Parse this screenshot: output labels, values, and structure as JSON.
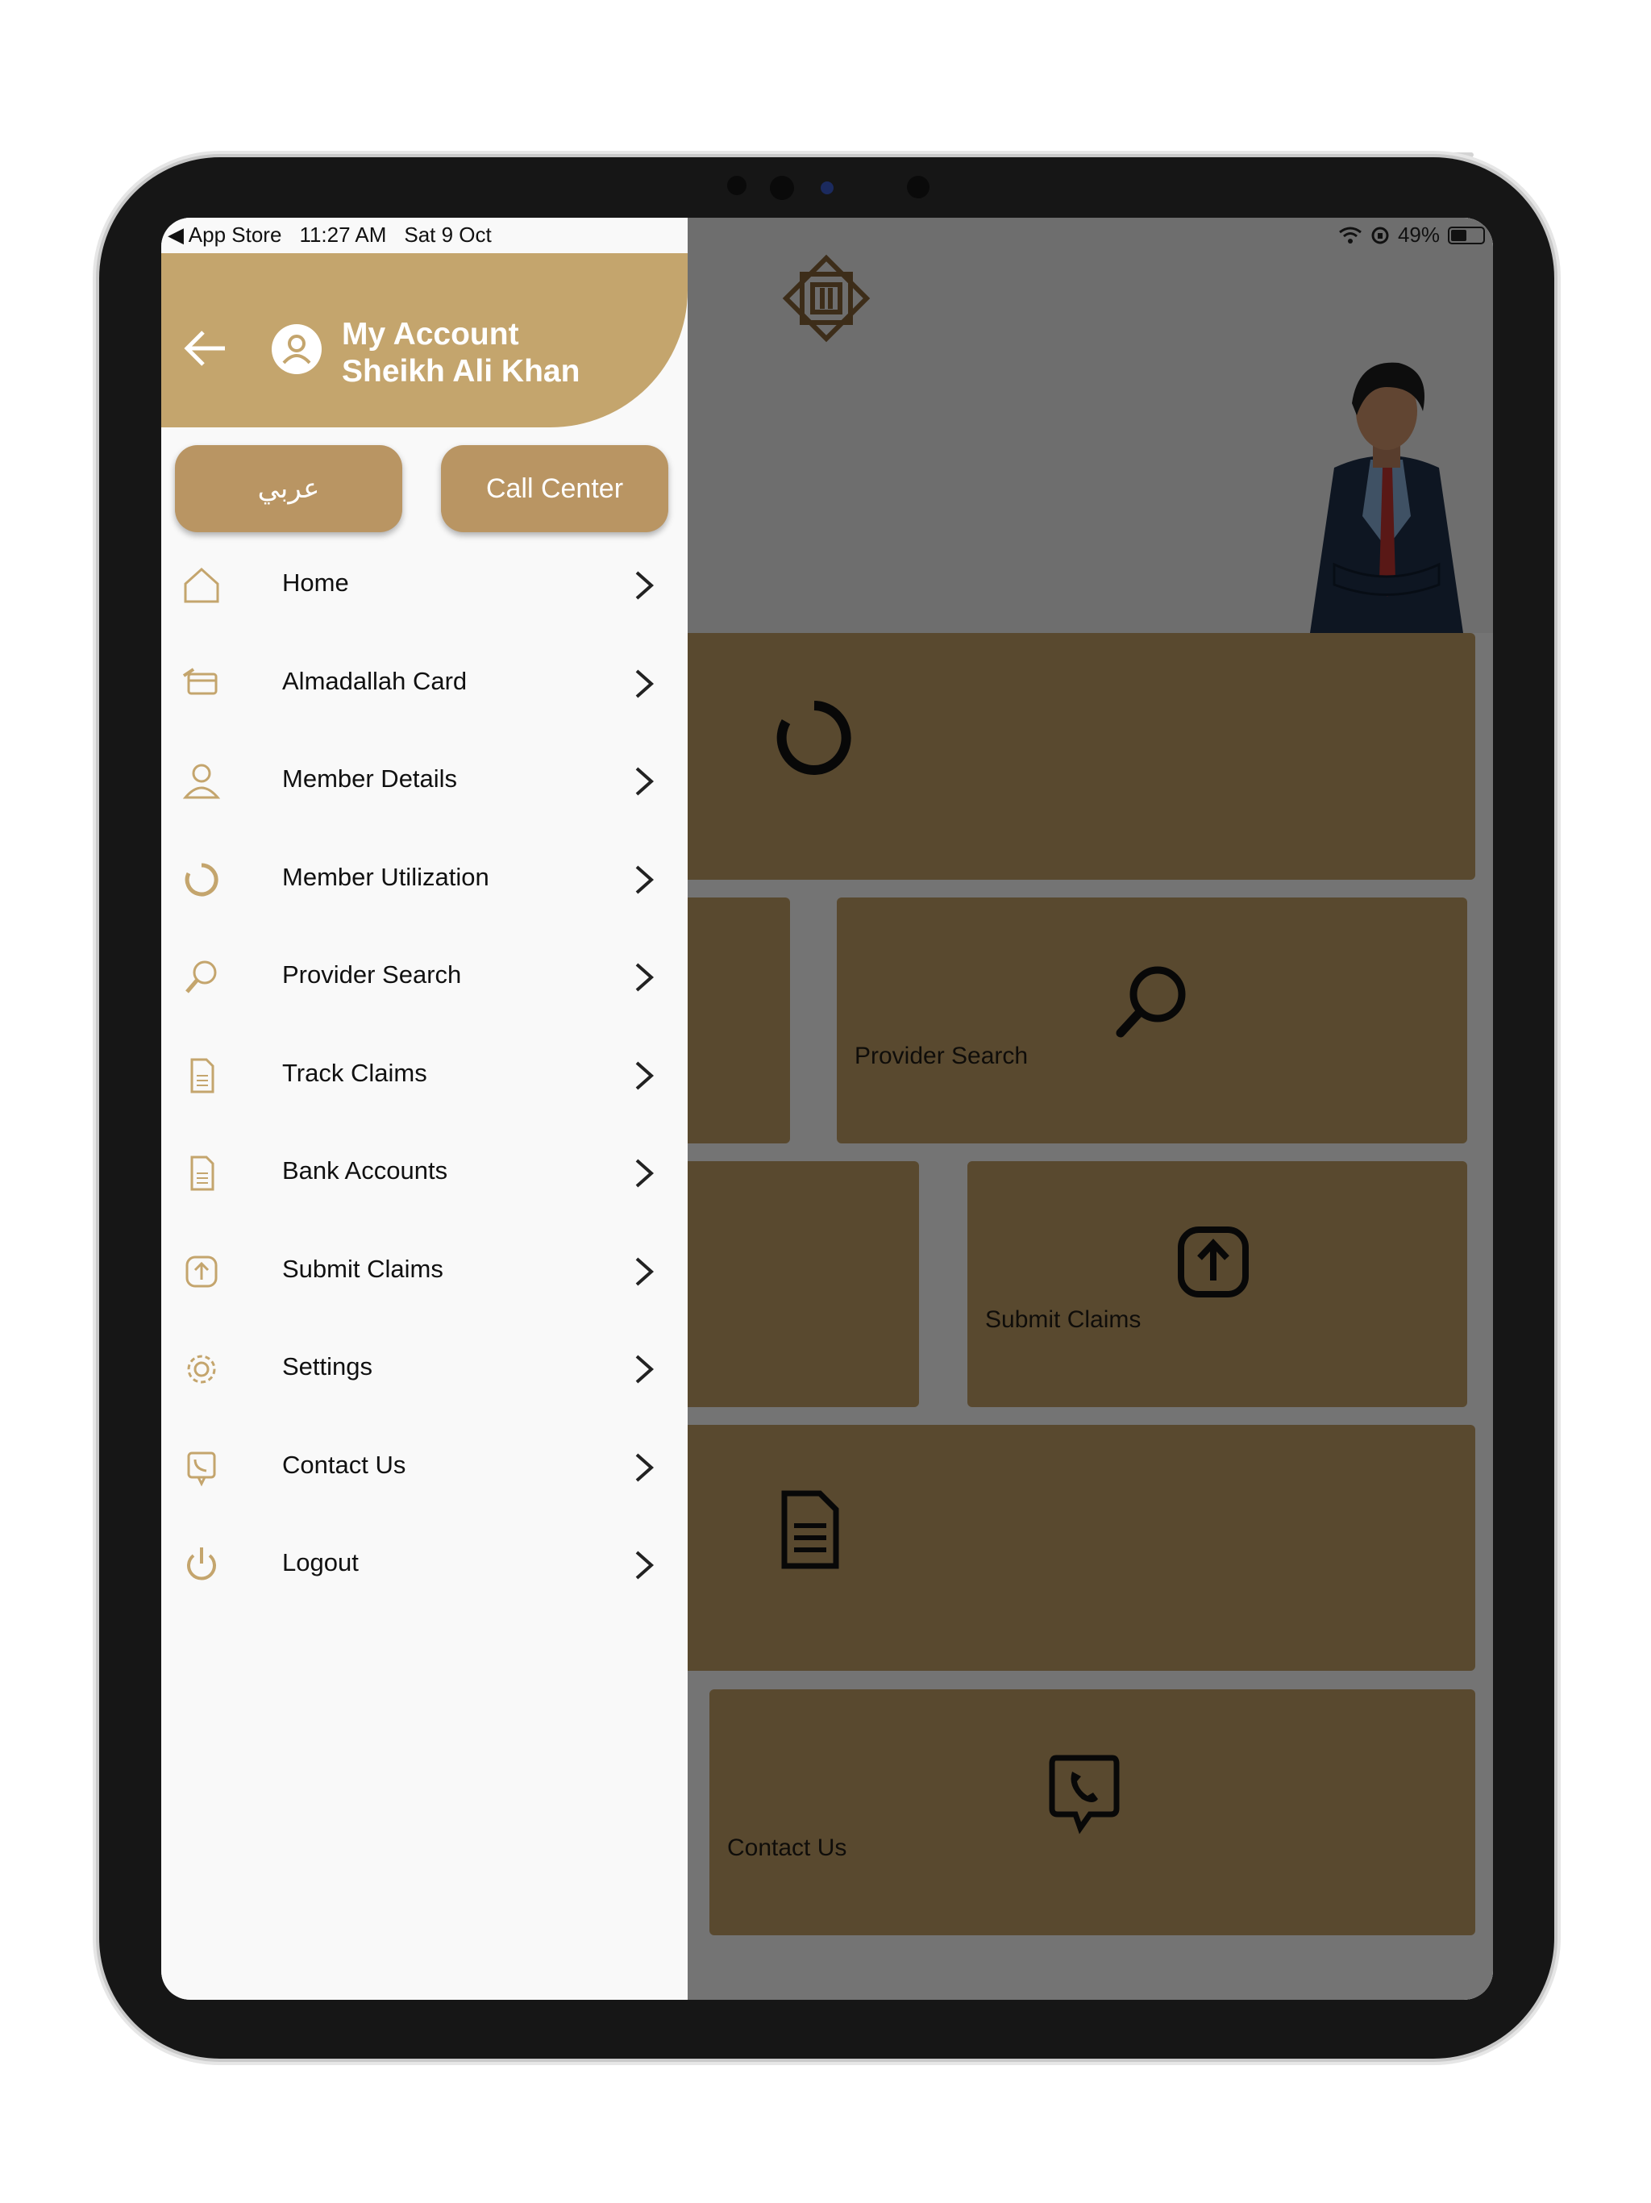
{
  "status_bar": {
    "back_app": "App Store",
    "time": "11:27 AM",
    "date": "Sat 9 Oct",
    "battery": "49%",
    "battery_level": 0.49
  },
  "drawer": {
    "title": "My Account",
    "user_name": "Sheikh Ali Khan",
    "arabic_button": "عربي",
    "call_center_button": "Call Center",
    "items": [
      {
        "label": "Home",
        "icon": "home-icon"
      },
      {
        "label": "Almadallah Card",
        "icon": "card-icon"
      },
      {
        "label": "Member Details",
        "icon": "user-icon"
      },
      {
        "label": "Member Utilization",
        "icon": "utilization-icon"
      },
      {
        "label": "Provider Search",
        "icon": "search-icon"
      },
      {
        "label": "Track Claims",
        "icon": "document-icon"
      },
      {
        "label": "Bank Accounts",
        "icon": "document-icon"
      },
      {
        "label": "Submit Claims",
        "icon": "upload-icon"
      },
      {
        "label": "Settings",
        "icon": "gear-icon"
      },
      {
        "label": "Contact Us",
        "icon": "phone-icon"
      },
      {
        "label": "Logout",
        "icon": "power-icon"
      }
    ]
  },
  "background": {
    "tiles": {
      "provider_search": "Provider Search",
      "submit_claims": "Submit Claims",
      "contact_us": "Contact Us"
    }
  },
  "colors": {
    "brand_gold": "#c4a56d",
    "button_gold": "#b99563",
    "tile_gold": "#b3925e"
  }
}
